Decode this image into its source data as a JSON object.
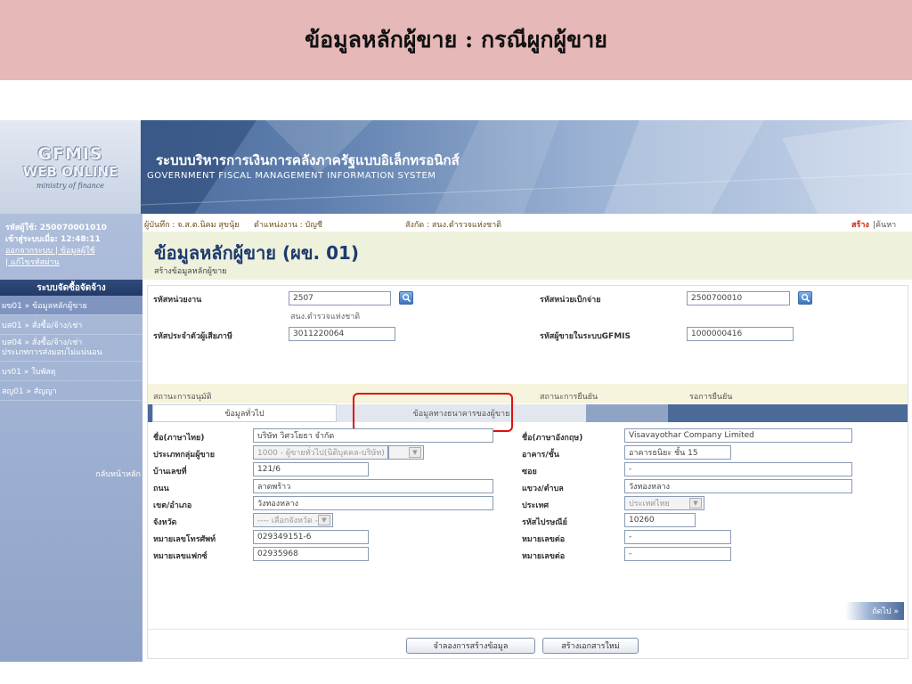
{
  "slide": {
    "title": "ข้อมูลหลักผู้ขาย : กรณีผูกผู้ขาย"
  },
  "banner": {
    "logo_main": "GFMIS",
    "logo_sub": "WEB ONLINE",
    "logo_tag": "ministry of finance",
    "title_th": "ระบบบริหารการเงินการคลังภาครัฐแบบอิเล็กทรอนิกส์",
    "title_en": "GOVERNMENT FISCAL MANAGEMENT INFORMATION SYSTEM"
  },
  "sidebar": {
    "user_id": "รหัสผู้ใช้: 250070001010",
    "login_time": "เข้าสู่ระบบเมื่อ: 12:48:11",
    "links_line1": "ออกจากระบบ | ข้อมูลผู้ใช้",
    "links_line2": "| แก้ไขรหัสผ่าน",
    "menu_header": "ระบบจัดซื้อจัดจ้าง",
    "items": [
      {
        "label": "ผข01 » ข้อมูลหลักผู้ขาย"
      },
      {
        "label": "บส01 » สั่งซื้อ/จ้าง/เช่า"
      },
      {
        "label_line1": "บส04 » สั่งซื้อ/จ้าง/เช่า",
        "label_line2": "ประเภทการส่งมอบไม่แน่นอน"
      },
      {
        "label": "บร01 » ใบพัสดุ"
      },
      {
        "label": "สญ01 » สัญญา"
      }
    ],
    "home_link": "กลับหน้าหลัก"
  },
  "infobar": {
    "recorder": "ผู้บันทึก : จ.ส.ต.นิคม สุขนุ้ย",
    "position": "ตำแหน่งงาน : บัญชี",
    "affiliation": "สังกัด : สนง.ตำรวจแห่งชาติ",
    "create": "สร้าง",
    "search": "|ค้นหา"
  },
  "page": {
    "title": "ข้อมูลหลักผู้ขาย (ผข. 01)",
    "subtitle": "สร้างข้อมูลหลักผู้ขาย"
  },
  "form": {
    "agency_code_label": "รหัสหน่วยงาน",
    "agency_code": "2507",
    "agency_name": "สนง.ตำรวจแห่งชาติ",
    "disbursing_unit_label": "รหัสหน่วยเบิกจ่าย",
    "disbursing_unit": "2500700010",
    "tax_id_label": "รหัสประจำตัวผู้เสียภาษี",
    "tax_id": "3011220064",
    "vendor_code_label": "รหัสผู้ขายในระบบGFMIS",
    "vendor_code": "1000000416",
    "approval_status_label": "สถานะการอนุมัติ",
    "confirm_status_label": "สถานะการยืนยัน",
    "confirm_status": "รอการยืนยัน",
    "tab_general": "ข้อมูลทั่วไป",
    "tab_bank": "ข้อมูลทางธนาคารของผู้ขาย",
    "name_th_label": "ชื่อ(ภาษาไทย)",
    "name_th": "บริษัท วิศวโยธา จำกัด",
    "name_en_label": "ชื่อ(ภาษาอังกฤษ)",
    "name_en": "Visavayothar Company Limited",
    "vendor_group_label": "ประเภทกลุ่มผู้ขาย",
    "vendor_group": "1000 - ผู้ขายทั่วไป(นิติบุคคล-บริษัท)",
    "building_label": "อาคาร/ชั้น",
    "building": "อาคารธนิยะ ชั้น 15",
    "house_no_label": "บ้านเลขที่",
    "house_no": "121/6",
    "soi_label": "ซอย",
    "soi": "-",
    "road_label": "ถนน",
    "road": "ลาดพร้าว",
    "subdistrict_label": "แขวง/ตำบล",
    "subdistrict": "วังทองหลาง",
    "district_label": "เขต/อำเภอ",
    "district": "วังทองหลาง",
    "country_label": "ประเทศ",
    "country": "ประเทศไทย",
    "province_label": "จังหวัด",
    "province": "---- เลือกจังหวัด ----",
    "postcode_label": "รหัสไปรษณีย์",
    "postcode": "10260",
    "phone_label": "หมายเลขโทรศัพท์",
    "phone": "029349151-6",
    "phone_ext_label": "หมายเลขต่อ",
    "phone_ext": "-",
    "fax_label": "หมายเลขแฟกซ์",
    "fax": "02935968",
    "fax_ext_label": "หมายเลขต่อ",
    "fax_ext": "-",
    "next": "ถัดไป »",
    "simulate_button": "จำลองการสร้างข้อมูล",
    "new_doc_button": "สร้างเอกสารใหม่"
  },
  "colors": {
    "title_bar": "#e6b8b7",
    "highlight": "#e01010",
    "tab_bar": "#4b6a98"
  }
}
